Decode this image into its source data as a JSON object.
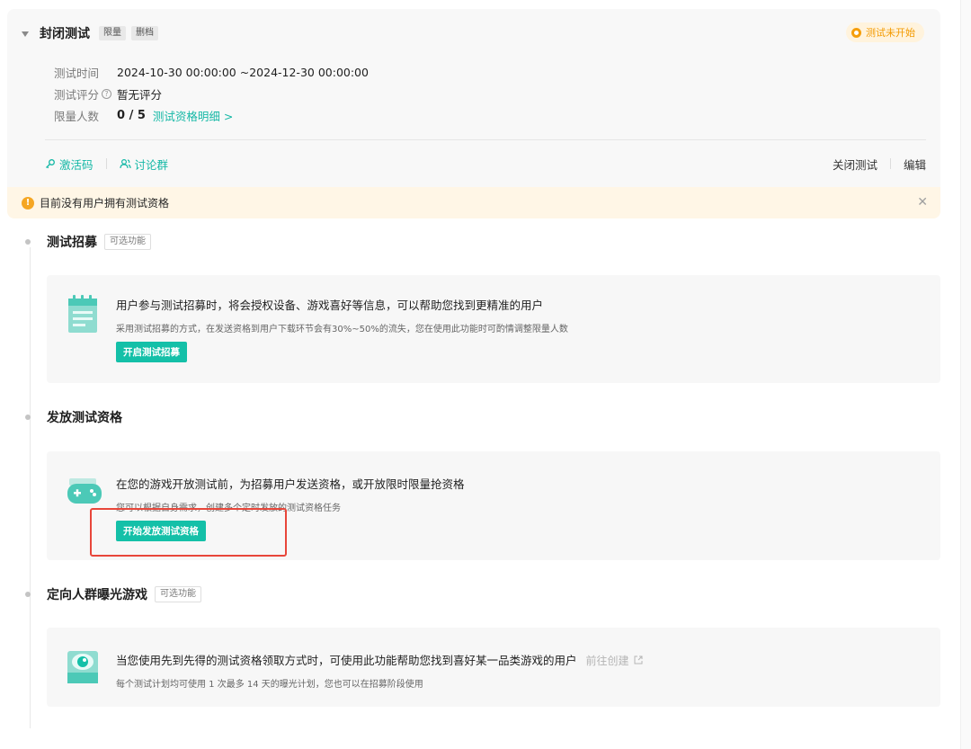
{
  "plan": {
    "title": "封闭测试",
    "tags": [
      "限量",
      "删档"
    ],
    "status": "测试未开始",
    "fields": {
      "time_label": "测试时间",
      "time_value": "2024-10-30 00:00:00 ~2024-12-30 00:00:00",
      "rating_label": "测试评分",
      "rating_value": "暂无评分",
      "quota_label": "限量人数",
      "quota_value": "0 / 5",
      "quota_link": "测试资格明细 >"
    },
    "toolbar": {
      "activation_code": "激活码",
      "discussion_group": "讨论群",
      "close_test": "关闭测试",
      "edit": "编辑"
    },
    "alert": "目前没有用户拥有测试资格"
  },
  "sections": [
    {
      "title": "测试招募",
      "tag": "可选功能",
      "headline": "用户参与测试招募时，将会授权设备、游戏喜好等信息，可以帮助您找到更精准的用户",
      "subtext": "采用测试招募的方式，在发送资格到用户下载环节会有30%~50%的流失，您在使用此功能时可酌情调整限量人数",
      "button": "开启测试招募"
    },
    {
      "title": "发放测试资格",
      "headline": "在您的游戏开放测试前，为招募用户发送资格，或开放限时限量抢资格",
      "subtext": "您可以根据自身需求，创建多个定时发放的测试资格任务",
      "button": "开始发放测试资格"
    },
    {
      "title": "定向人群曝光游戏",
      "tag": "可选功能",
      "headline": "当您使用先到先得的测试资格领取方式时，可使用此功能帮助您找到喜好某一品类游戏的用户",
      "link": "前往创建",
      "subtext": "每个测试计划均可使用 1 次最多 14 天的曝光计划，您也可以在招募阶段使用"
    }
  ],
  "colors": {
    "accent": "#14c0a8",
    "warning": "#f5a623",
    "highlight": "#e8463a"
  }
}
